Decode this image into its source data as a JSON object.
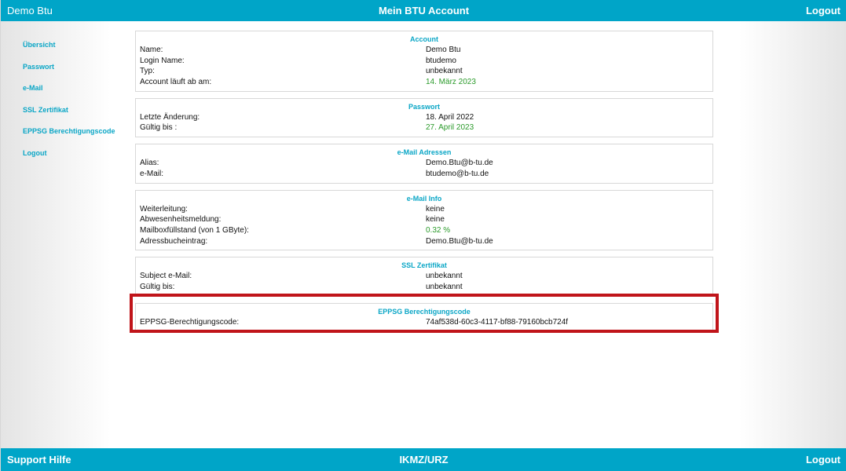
{
  "header": {
    "user_name": "Demo Btu",
    "title": "Mein BTU Account",
    "logout_label": "Logout"
  },
  "sidebar": {
    "items": [
      {
        "label": "Übersicht"
      },
      {
        "label": "Passwort"
      },
      {
        "label": "e-Mail"
      },
      {
        "label": "SSL Zertifikat"
      },
      {
        "label": "EPPSG Berechtigungscode"
      },
      {
        "label": "Logout"
      }
    ]
  },
  "sections": {
    "account": {
      "title": "Account",
      "rows": [
        {
          "label": "Name:",
          "value": "Demo Btu"
        },
        {
          "label": "Login Name:",
          "value": "btudemo"
        },
        {
          "label": "Typ:",
          "value": "unbekannt"
        },
        {
          "label": "Account läuft ab am:",
          "value": "14. März 2023"
        }
      ]
    },
    "password": {
      "title": "Passwort",
      "rows": [
        {
          "label": "Letzte Änderung:",
          "value": "18. April 2022"
        },
        {
          "label": "Gültig bis :",
          "value": "27. April 2023"
        }
      ]
    },
    "email_addresses": {
      "title": "e-Mail Adressen",
      "rows": [
        {
          "label": "Alias:",
          "value": "Demo.Btu@b-tu.de"
        },
        {
          "label": "e-Mail:",
          "value": "btudemo@b-tu.de"
        }
      ]
    },
    "email_info": {
      "title": "e-Mail Info",
      "rows": [
        {
          "label": "Weiterleitung:",
          "value": "keine"
        },
        {
          "label": "Abwesenheitsmeldung:",
          "value": "keine"
        },
        {
          "label": "Mailboxfüllstand (von 1 GByte):",
          "value": "0.32 %"
        },
        {
          "label": "Adressbucheintrag:",
          "value": "Demo.Btu@b-tu.de"
        }
      ]
    },
    "ssl": {
      "title": "SSL Zertifikat",
      "rows": [
        {
          "label": "Subject e-Mail:",
          "value": "unbekannt"
        },
        {
          "label": "Gültig bis:",
          "value": "unbekannt"
        }
      ]
    },
    "eppsg": {
      "title": "EPPSG Berechtigungscode",
      "rows": [
        {
          "label": "EPPSG-Berechtigungscode:",
          "value": "74af538d-60c3-4117-bf88-79160bcb724f"
        }
      ]
    }
  },
  "footer": {
    "support_label": "Support Hilfe",
    "center_label": "IKMZ/URZ",
    "logout_label": "Logout"
  },
  "colors": {
    "accent": "#00a5c8",
    "link": "#0aa6c6",
    "positive": "#2a9a2a",
    "highlight_border": "#c0141a"
  }
}
